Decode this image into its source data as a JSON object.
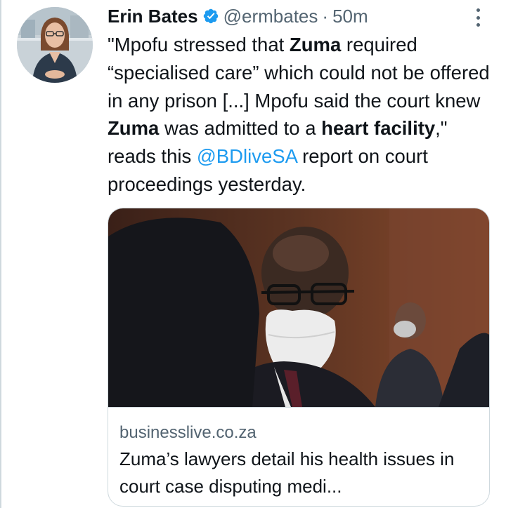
{
  "tweet": {
    "author": {
      "name": "Erin Bates",
      "handle": "@ermbates",
      "verified": true
    },
    "separator": "·",
    "time": "50m",
    "text": {
      "p1": "\"Mpofu stressed that ",
      "b1": "Zuma",
      "p2": " required “specialised care” which could not be offered in any prison [...] Mpofu said the court knew ",
      "b2": "Zuma",
      "p3": " was admitted to a ",
      "b3": "heart facility",
      "p4": ",\" reads this ",
      "mention": "@BDliveSA",
      "p5": " report on court proceedings yesterday."
    },
    "card": {
      "domain": "businesslive.co.za",
      "title": "Zuma’s lawyers detail his health issues in court case disputing medi..."
    }
  },
  "icons": {
    "verified": "verified-badge-icon",
    "more": "more-options-icon"
  },
  "colors": {
    "link": "#1d9bf0",
    "secondary_text": "#536471",
    "border": "#cfd9de"
  }
}
